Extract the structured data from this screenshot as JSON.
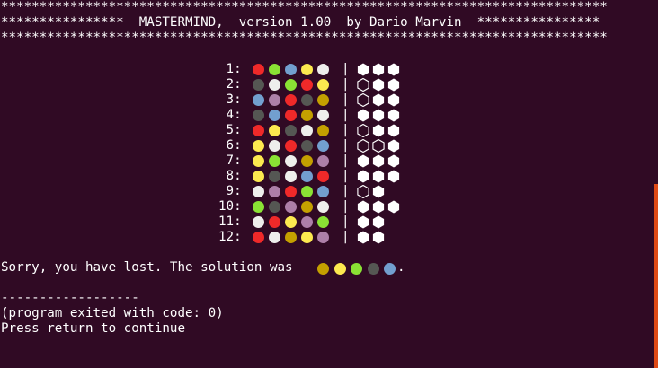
{
  "colors": {
    "background": "#300a24",
    "text": "#ffffff",
    "scrollbar": "#df4a16"
  },
  "peg_colors": {
    "red": "#ef2929",
    "green": "#8ae234",
    "blue": "#729fcf",
    "yellow": "#fce94f",
    "white": "#eeeeec",
    "gray": "#555753",
    "mauve": "#ad7fa8",
    "gold": "#c4a000"
  },
  "header": {
    "border": "*******************************************************************************",
    "title_line": "****************  MASTERMIND,  version 1.00  by Dario Marvin  ****************"
  },
  "separator": "|",
  "rows": [
    {
      "label": "1:",
      "pegs": [
        "red",
        "green",
        "blue",
        "yellow",
        "white"
      ],
      "feedback": [
        "full",
        "full",
        "full"
      ]
    },
    {
      "label": "2:",
      "pegs": [
        "gray",
        "white",
        "green",
        "red",
        "yellow"
      ],
      "feedback": [
        "empty",
        "full",
        "full"
      ]
    },
    {
      "label": "3:",
      "pegs": [
        "blue",
        "mauve",
        "red",
        "gray",
        "gold"
      ],
      "feedback": [
        "empty",
        "full",
        "full"
      ]
    },
    {
      "label": "4:",
      "pegs": [
        "gray",
        "blue",
        "red",
        "gold",
        "white"
      ],
      "feedback": [
        "full",
        "full",
        "full"
      ]
    },
    {
      "label": "5:",
      "pegs": [
        "red",
        "yellow",
        "gray",
        "white",
        "gold"
      ],
      "feedback": [
        "empty",
        "full",
        "full"
      ]
    },
    {
      "label": "6:",
      "pegs": [
        "yellow",
        "white",
        "red",
        "gray",
        "blue"
      ],
      "feedback": [
        "empty",
        "empty",
        "full"
      ]
    },
    {
      "label": "7:",
      "pegs": [
        "yellow",
        "green",
        "white",
        "gold",
        "mauve"
      ],
      "feedback": [
        "full",
        "full",
        "full"
      ]
    },
    {
      "label": "8:",
      "pegs": [
        "yellow",
        "gray",
        "white",
        "blue",
        "red"
      ],
      "feedback": [
        "full",
        "full",
        "full"
      ]
    },
    {
      "label": "9:",
      "pegs": [
        "white",
        "mauve",
        "red",
        "green",
        "blue"
      ],
      "feedback": [
        "empty",
        "full"
      ]
    },
    {
      "label": "10:",
      "pegs": [
        "green",
        "gray",
        "mauve",
        "gold",
        "white"
      ],
      "feedback": [
        "full",
        "full",
        "full"
      ]
    },
    {
      "label": "11:",
      "pegs": [
        "white",
        "red",
        "yellow",
        "mauve",
        "green"
      ],
      "feedback": [
        "full",
        "full"
      ]
    },
    {
      "label": "12:",
      "pegs": [
        "red",
        "white",
        "gold",
        "yellow",
        "mauve"
      ],
      "feedback": [
        "full",
        "full"
      ]
    }
  ],
  "result": {
    "message": "Sorry, you have lost. The solution was",
    "solution": [
      "gold",
      "yellow",
      "green",
      "gray",
      "blue"
    ],
    "end_punct": "."
  },
  "footer": {
    "dashes": "------------------",
    "exit_message": "(program exited with code: 0)",
    "prompt": "Press return to continue"
  }
}
